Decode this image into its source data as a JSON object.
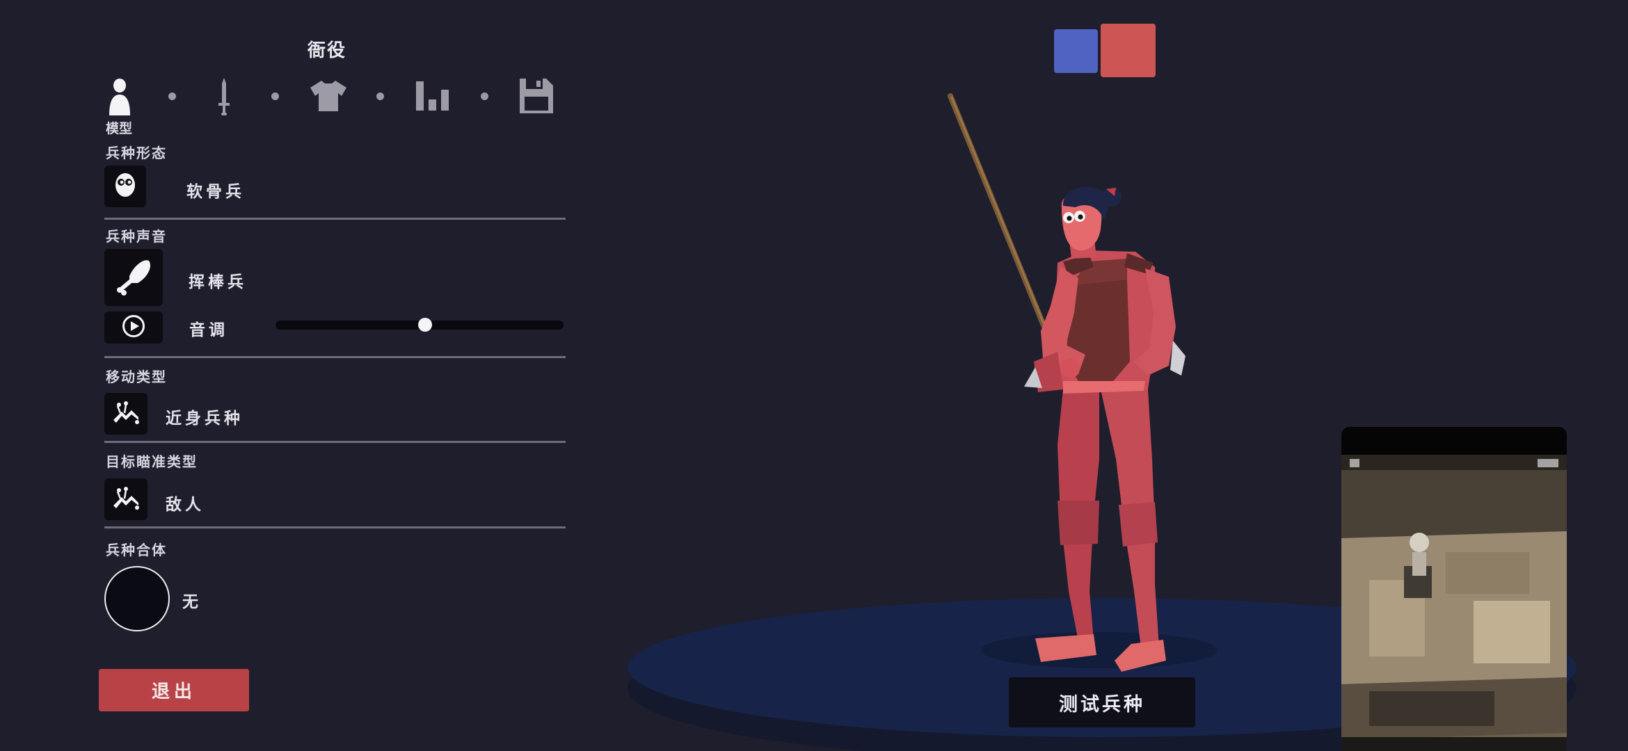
{
  "editor": {
    "unit_name": "衙役",
    "tabs": [
      {
        "icon": "unit-model-icon",
        "label": "模型"
      },
      {
        "icon": "weapon-sword-icon"
      },
      {
        "icon": "clothing-shirt-icon"
      },
      {
        "icon": "stats-bars-icon"
      },
      {
        "icon": "save-disk-icon"
      }
    ],
    "sections": {
      "form": {
        "title": "兵种形态",
        "value": "软骨兵",
        "icon": "bean-face-icon"
      },
      "voice": {
        "title": "兵种声音",
        "value": "挥棒兵",
        "icon": "drumstick-icon",
        "pitch_label": "音调",
        "pitch_level": 0.52,
        "play_icon": "play-icon"
      },
      "movement": {
        "title": "移动类型",
        "value": "近身兵种",
        "icon": "charge-unit-icon"
      },
      "targeting": {
        "title": "目标瞄准类型",
        "value": "敌人",
        "icon": "target-unit-icon"
      },
      "combination": {
        "title": "兵种合体",
        "value": "无"
      }
    },
    "exit_label": "退出"
  },
  "scene": {
    "team_colors": {
      "blue": "#5062c2",
      "red": "#cd5654"
    },
    "test_label": "测试兵种",
    "unit_preview": "red-spearman-figure",
    "pip_overlay": "game-capture-thumbnail"
  }
}
